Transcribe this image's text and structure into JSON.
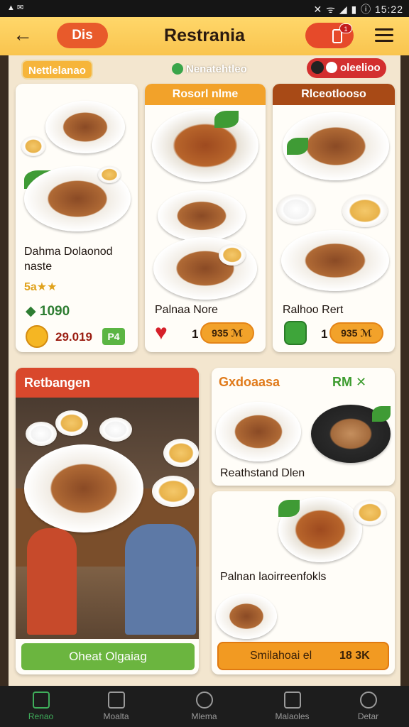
{
  "status": {
    "left": "▲ ✉",
    "right": "✕ ᯤ ◢ ▮ ⓘ 15:22"
  },
  "appbar": {
    "back": "←",
    "left_pill": "Dis",
    "title": "Restrania",
    "badge": "1"
  },
  "filters": {
    "chip1": "Nettlelanao",
    "chip2": "Nenatehtleo",
    "chip3": "oleelioo"
  },
  "cards": [
    {
      "header": "",
      "name": "Dahma Dolaonod naste",
      "rating": "5a★★",
      "likes": "1090",
      "price": "29.019",
      "tag": "P4"
    },
    {
      "header": "Rosorl nlme",
      "name": "Palnaa Nore",
      "count": "1",
      "price": "935 ℳ"
    },
    {
      "header": "Rlceotlooso",
      "name": "Ralhoo Rert",
      "count": "1",
      "price": "935 ℳ"
    }
  ],
  "restaurant": {
    "header": "Retbangen",
    "action": "Oheat Olgaiag"
  },
  "right_panel": {
    "header": "Gxdoaasa",
    "header_price": "RM ✕",
    "item1": "Reathstand Dlen",
    "item2": "Palnan laoirreenfokls",
    "action": "Smilahoai el",
    "action_price": "18 3K"
  },
  "nav": [
    {
      "label": "Renao",
      "icon": "home-icon"
    },
    {
      "label": "Moalta",
      "icon": "basket-icon"
    },
    {
      "label": "Mlema",
      "icon": "circle-icon"
    },
    {
      "label": "Malaoles",
      "icon": "book-icon"
    },
    {
      "label": "Detar",
      "icon": "compass-icon"
    }
  ],
  "colors": {
    "brand": "#f9c44e",
    "accent": "#e85a2b",
    "green": "#3fae5b",
    "orange": "#f2a22a"
  }
}
